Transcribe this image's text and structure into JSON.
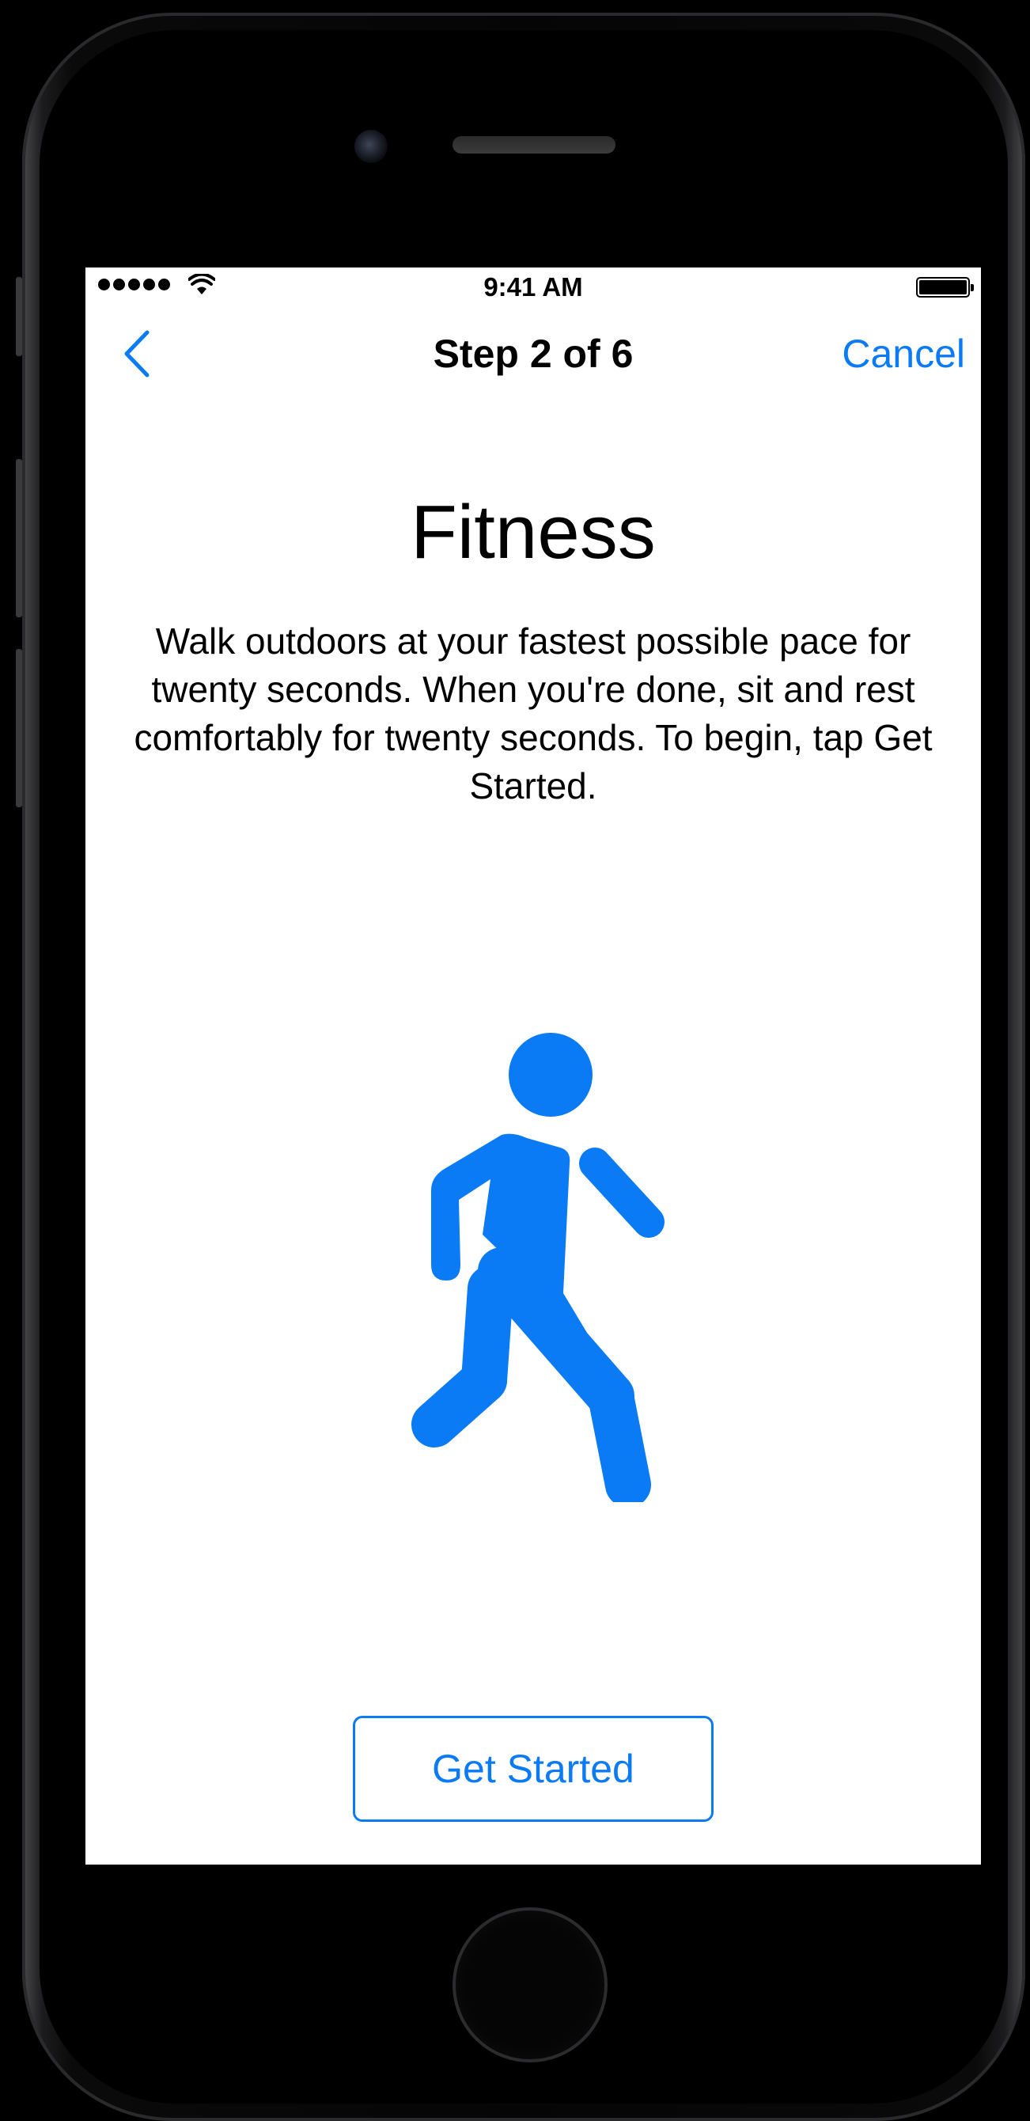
{
  "status_bar": {
    "time": "9:41 AM",
    "signal_dots": 5,
    "icons": [
      "signal-dots-icon",
      "wifi-icon",
      "battery-icon"
    ]
  },
  "nav": {
    "back_icon": "chevron-left-icon",
    "title": "Step 2 of 6",
    "cancel_label": "Cancel"
  },
  "content": {
    "title": "Fitness",
    "description": "Walk outdoors at your fastest possible pace for twenty seconds. When you're done, sit and rest comfortably for twenty seconds. To begin, tap Get Started.",
    "illustration_icon": "walking-person-icon"
  },
  "actions": {
    "primary_label": "Get Started"
  },
  "colors": {
    "accent": "#0a7af5",
    "screen_background": "#ffffff",
    "device_frame": "#000000"
  }
}
